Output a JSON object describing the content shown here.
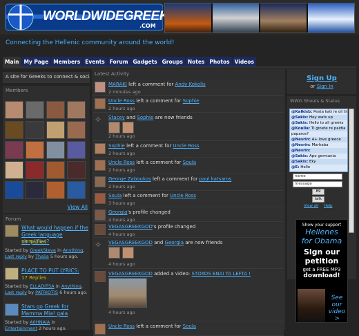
{
  "site": {
    "logo": "WORLDWIDEGREEKS",
    "logo_com": ".COM",
    "tagline": "Connecting the Hellenic community around the world!"
  },
  "nav": [
    "Main",
    "My Page",
    "Members",
    "Events",
    "Forum",
    "Gadgets",
    "Groups",
    "Notes",
    "Photos",
    "Videos"
  ],
  "intro": "A site for Greeks to connect & socialize",
  "members": {
    "title": "Members",
    "view_all": "View All"
  },
  "forum": {
    "title": "Forum",
    "topics": [
      {
        "title": "What would happen if the Greek language simplified?",
        "replies": "29 Replies",
        "started_prefix": "Started by",
        "author": "GreekSteve",
        "in": "in",
        "category": "Anything",
        "last": "Last reply",
        "last_by": "by",
        "last_user": "Thalia",
        "ago": "5 hours ago."
      },
      {
        "title": "PLACE TO PUT LYRICS:",
        "replies": "17 Replies",
        "started_prefix": "Started by",
        "author": "ELLADITSA",
        "in": "in",
        "category": "Anything",
        "last": "Last reply",
        "last_by": "by",
        "last_user": "PATRIOTIS",
        "ago": "6 hours ago."
      },
      {
        "title": "Stars go Greek for Mamma Mia! gala",
        "replies": "",
        "started_prefix": "Started by",
        "author": "A0HNAIA",
        "in": "in",
        "category": "Entertainment",
        "last": "",
        "last_by": "",
        "last_user": "",
        "ago": "2 hours ago."
      }
    ]
  },
  "activity": {
    "title": "Latest Activity",
    "items": [
      {
        "a": "MARAKI",
        "mid": " left a comment for ",
        "b": "Andy Kokolis",
        "time": "2 minutes ago"
      },
      {
        "a": "Uncle Ross",
        "mid": " left a comment for ",
        "b": "Sophie",
        "time": "2 hours ago"
      },
      {
        "a": "Stacey",
        "mid": " and ",
        "b": "Sophie",
        "tail": " are now friends",
        "time": "2 hours ago"
      },
      {
        "a": "Sophie",
        "mid": " left a comment for ",
        "b": "Uncle Ross",
        "time": "2 hours ago"
      },
      {
        "a": "Uncle Ross",
        "mid": " left a comment for ",
        "b": "Soula",
        "time": "2 hours ago"
      },
      {
        "a": "George Zaboukos",
        "mid": " left a comment for ",
        "b": "paul katsaros",
        "time": "2 hours ago"
      },
      {
        "a": "Soula",
        "mid": " left a comment for ",
        "b": "Uncle Ross",
        "time": "3 hours ago"
      },
      {
        "a": "Georgia",
        "mid": "'s profile changed",
        "b": "",
        "time": "4 hours ago"
      },
      {
        "a": "VEGASGREEKGOD",
        "mid": "'s profile changed",
        "b": "",
        "time": "4 hours ago"
      },
      {
        "a": "VEGASGREEKGOD",
        "mid": " and ",
        "b": "Georgia",
        "tail": " are now friends",
        "time": "4 hours ago"
      },
      {
        "a": "VEGASGREEKGOD",
        "mid": " added a video: ",
        "b": "STOXOS ENAI TA LEFTA !",
        "time": "4 hours ago"
      },
      {
        "a": "Uncle Ross",
        "mid": " left a comment for ",
        "b": "Soula",
        "time": ""
      }
    ]
  },
  "signup": {
    "label": "Sign Up",
    "or": "or",
    "signin": "Sign In"
  },
  "shout": {
    "title": "WWG Shouts & Status",
    "lines": [
      {
        "u": "@Kalkisb:",
        "t": " Pesta kati re oli tin poppya kana ta milista akou"
      },
      {
        "u": "@Sakis:",
        "t": " Hey wats up"
      },
      {
        "u": "@Sakis:",
        "t": " Hello to all greeks"
      },
      {
        "u": "@Koulla:",
        "t": " Ti ginete re paidia"
      },
      {
        "u": "",
        "t": "paparos?"
      },
      {
        "u": "@Nesrin:",
        "t": " A+ love greece"
      },
      {
        "u": "@Nesrin:",
        "t": " Marhaba"
      },
      {
        "u": "@Nesrin:",
        "t": ""
      },
      {
        "u": "@Sakis:",
        "t": " Apo germania"
      },
      {
        "u": "@Sakis:",
        "t": " Eky"
      },
      {
        "u": "@E:",
        "t": " Hello"
      }
    ],
    "name": "name",
    "message": "message",
    "count": "89",
    "talk": "talk",
    "view_all": "View all",
    "help": "Help"
  },
  "ad": {
    "l1": "Show your support",
    "l2": "Hellenes",
    "l3": "for Obama",
    "l4": "Sign our",
    "l5": "petition",
    "l6": "get a FREE MP3",
    "l7": "download!",
    "l8": "See",
    "l9": "our",
    "l10": "video >"
  }
}
